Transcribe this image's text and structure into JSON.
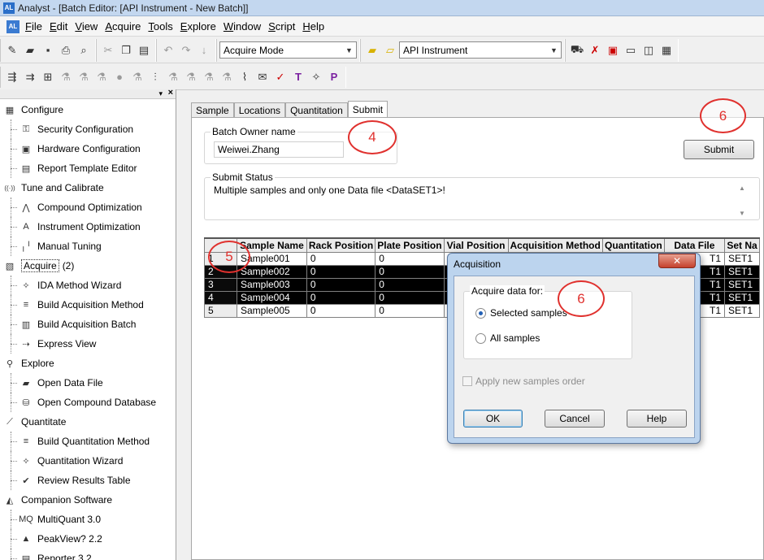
{
  "window": {
    "title": "Analyst - [Batch Editor: [API Instrument - New Batch]]",
    "app_icon": "AL"
  },
  "menu": [
    "File",
    "Edit",
    "View",
    "Acquire",
    "Tools",
    "Explore",
    "Window",
    "Script",
    "Help"
  ],
  "toolbar": {
    "mode_combo": "Acquire Mode",
    "instrument_combo": "API Instrument"
  },
  "sidebar": {
    "items": [
      {
        "type": "cat",
        "label": "Configure",
        "icon": "configure-icon",
        "glyph": "▦"
      },
      {
        "type": "sub",
        "label": "Security Configuration",
        "icon": "key-icon",
        "glyph": "⚿"
      },
      {
        "type": "sub",
        "label": "Hardware Configuration",
        "icon": "hardware-icon",
        "glyph": "▣"
      },
      {
        "type": "sub",
        "label": "Report Template Editor",
        "icon": "report-icon",
        "glyph": "▤"
      },
      {
        "type": "cat",
        "label": "Tune and Calibrate",
        "icon": "tune-icon",
        "glyph": "((·))"
      },
      {
        "type": "sub",
        "label": "Compound Optimization",
        "icon": "compound-icon",
        "glyph": "⋀"
      },
      {
        "type": "sub",
        "label": "Instrument Optimization",
        "icon": "instrument-icon",
        "glyph": "A"
      },
      {
        "type": "sub",
        "label": "Manual Tuning",
        "icon": "manual-tuning-icon",
        "glyph": "╷╵"
      },
      {
        "type": "cat",
        "label": "Acquire",
        "icon": "acquire-icon",
        "glyph": "▧",
        "badge": "(2)",
        "active": true
      },
      {
        "type": "sub",
        "label": "IDA Method Wizard",
        "icon": "wand-icon",
        "glyph": "✧"
      },
      {
        "type": "sub",
        "label": "Build Acquisition Method",
        "icon": "method-icon",
        "glyph": "≡"
      },
      {
        "type": "sub",
        "label": "Build Acquisition Batch",
        "icon": "batch-icon",
        "glyph": "▥"
      },
      {
        "type": "sub",
        "label": "Express View",
        "icon": "express-icon",
        "glyph": "⇢"
      },
      {
        "type": "cat",
        "label": "Explore",
        "icon": "explore-icon",
        "glyph": "⚲"
      },
      {
        "type": "sub",
        "label": "Open Data File",
        "icon": "folder-icon",
        "glyph": "▰"
      },
      {
        "type": "sub",
        "label": "Open Compound Database",
        "icon": "database-icon",
        "glyph": "⛁"
      },
      {
        "type": "cat",
        "label": "Quantitate",
        "icon": "quantitate-icon",
        "glyph": "⟋"
      },
      {
        "type": "sub",
        "label": "Build Quantitation Method",
        "icon": "quant-method-icon",
        "glyph": "≡"
      },
      {
        "type": "sub",
        "label": "Quantitation Wizard",
        "icon": "wand-icon",
        "glyph": "✧"
      },
      {
        "type": "sub",
        "label": "Review Results Table",
        "icon": "results-icon",
        "glyph": "✔"
      },
      {
        "type": "cat",
        "label": "Companion Software",
        "icon": "companion-icon",
        "glyph": "◭"
      },
      {
        "type": "sub",
        "label": "MultiQuant 3.0",
        "icon": "multiquant-icon",
        "glyph": "MQ"
      },
      {
        "type": "sub",
        "label": "PeakView? 2.2",
        "icon": "peakview-icon",
        "glyph": "▲"
      },
      {
        "type": "sub",
        "label": "Reporter 3.2",
        "icon": "reporter-icon",
        "glyph": "▤"
      }
    ]
  },
  "tabs": [
    "Sample",
    "Locations",
    "Quantitation",
    "Submit"
  ],
  "submit": {
    "batch_owner_label": "Batch Owner name",
    "batch_owner_value": "Weiwei.Zhang",
    "submit_button": "Submit",
    "status_label": "Submit Status",
    "status_text": "Multiple samples and only one Data file <DataSET1>!"
  },
  "grid": {
    "headers": [
      "",
      "Sample Name",
      "Rack Position",
      "Plate Position",
      "Vial Position",
      "Acquisition Method",
      "Quantitation",
      "Data File",
      "Set Na"
    ],
    "rows": [
      {
        "num": "1",
        "name": "Sample001",
        "rack": "0",
        "plate": "0",
        "data": "T1",
        "set": "SET1",
        "selected": false
      },
      {
        "num": "2",
        "name": "Sample002",
        "rack": "0",
        "plate": "0",
        "data": "T1",
        "set": "SET1",
        "selected": true
      },
      {
        "num": "3",
        "name": "Sample003",
        "rack": "0",
        "plate": "0",
        "data": "T1",
        "set": "SET1",
        "selected": true
      },
      {
        "num": "4",
        "name": "Sample004",
        "rack": "0",
        "plate": "0",
        "data": "T1",
        "set": "SET1",
        "selected": true
      },
      {
        "num": "5",
        "name": "Sample005",
        "rack": "0",
        "plate": "0",
        "data": "T1",
        "set": "SET1",
        "selected": false
      }
    ]
  },
  "dialog": {
    "title": "Acquisition",
    "close": "✕",
    "group_label": "Acquire data for:",
    "option_selected": "Selected samples",
    "option_all": "All samples",
    "apply_order": "Apply new samples order",
    "ok": "OK",
    "cancel": "Cancel",
    "help": "Help"
  },
  "annotations": {
    "a4": "4",
    "a5": "5",
    "a6_submit": "6",
    "a6_dialog": "6"
  }
}
